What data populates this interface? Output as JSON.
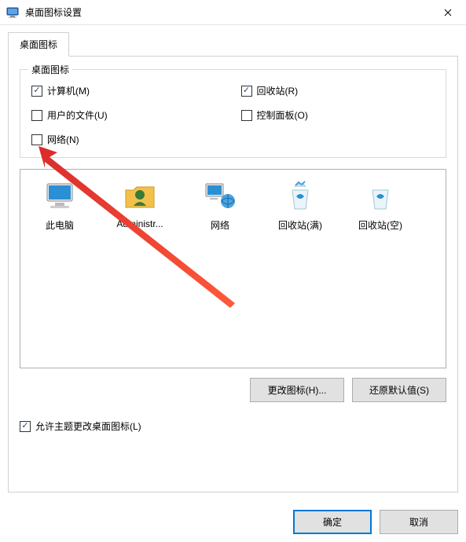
{
  "titlebar": {
    "title": "桌面图标设置"
  },
  "tab": {
    "label": "桌面图标"
  },
  "group": {
    "title": "桌面图标",
    "checks": {
      "computer": {
        "label": "计算机(M)",
        "checked": true
      },
      "recycle": {
        "label": "回收站(R)",
        "checked": true
      },
      "userfiles": {
        "label": "用户的文件(U)",
        "checked": false
      },
      "cpanel": {
        "label": "控制面板(O)",
        "checked": false
      },
      "network": {
        "label": "网络(N)",
        "checked": false
      }
    }
  },
  "preview": {
    "thispc": "此电脑",
    "admin": "Administr...",
    "network": "网络",
    "rbfull": "回收站(满)",
    "rbempty": "回收站(空)"
  },
  "actions": {
    "changeIcon": "更改图标(H)...",
    "restoreDefault": "还原默认值(S)"
  },
  "allowThemes": {
    "label": "允许主题更改桌面图标(L)",
    "checked": true
  },
  "dialog": {
    "ok": "确定",
    "cancel": "取消"
  }
}
